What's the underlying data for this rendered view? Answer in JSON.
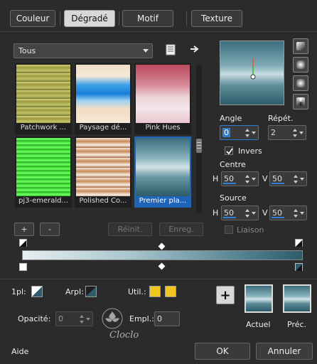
{
  "tabs": [
    {
      "label": "Couleur"
    },
    {
      "label": "Dégradé"
    },
    {
      "label": "Motif"
    },
    {
      "label": "Texture"
    }
  ],
  "category": {
    "selected": "Tous"
  },
  "gradients": [
    {
      "label": "Patchwork ..."
    },
    {
      "label": "Paysage dé..."
    },
    {
      "label": "Pink Hues"
    },
    {
      "label": "pj3-emerald..."
    },
    {
      "label": "Polished Co..."
    },
    {
      "label": "Premier pla..."
    }
  ],
  "buttons": {
    "add": "+",
    "remove": "-",
    "reset": "Réinit.",
    "save": "Enreg.",
    "add_marker": "+",
    "ok": "OK",
    "cancel": "Annuler"
  },
  "settings": {
    "angle_label": "Angle",
    "angle_value": "0",
    "repeat_label": "Répét.",
    "repeat_value": "2",
    "invert_label": "Invers",
    "center_label": "Centre",
    "center_h_label": "H",
    "center_h": "50",
    "center_v_label": "V",
    "center_v": "50",
    "source_label": "Source",
    "source_h_label": "H",
    "source_h": "50",
    "source_v_label": "V",
    "source_v": "50",
    "link_label": "Liaison"
  },
  "bottom": {
    "first_plan_label": "1pl:",
    "arrpl_label": "Arpl:",
    "util_label": "Util.:",
    "opacity_label": "Opacité:",
    "opacity_value": "0",
    "empl_label": "Empl.:",
    "empl_value": "0",
    "current_label": "Actuel",
    "previous_label": "Préc.",
    "help_label": "Aide"
  },
  "watermark": "Cloclo",
  "colors": {
    "accent": "#1e64b8",
    "util_swatch": "#f2c41e",
    "background": "#2b2b2b"
  }
}
